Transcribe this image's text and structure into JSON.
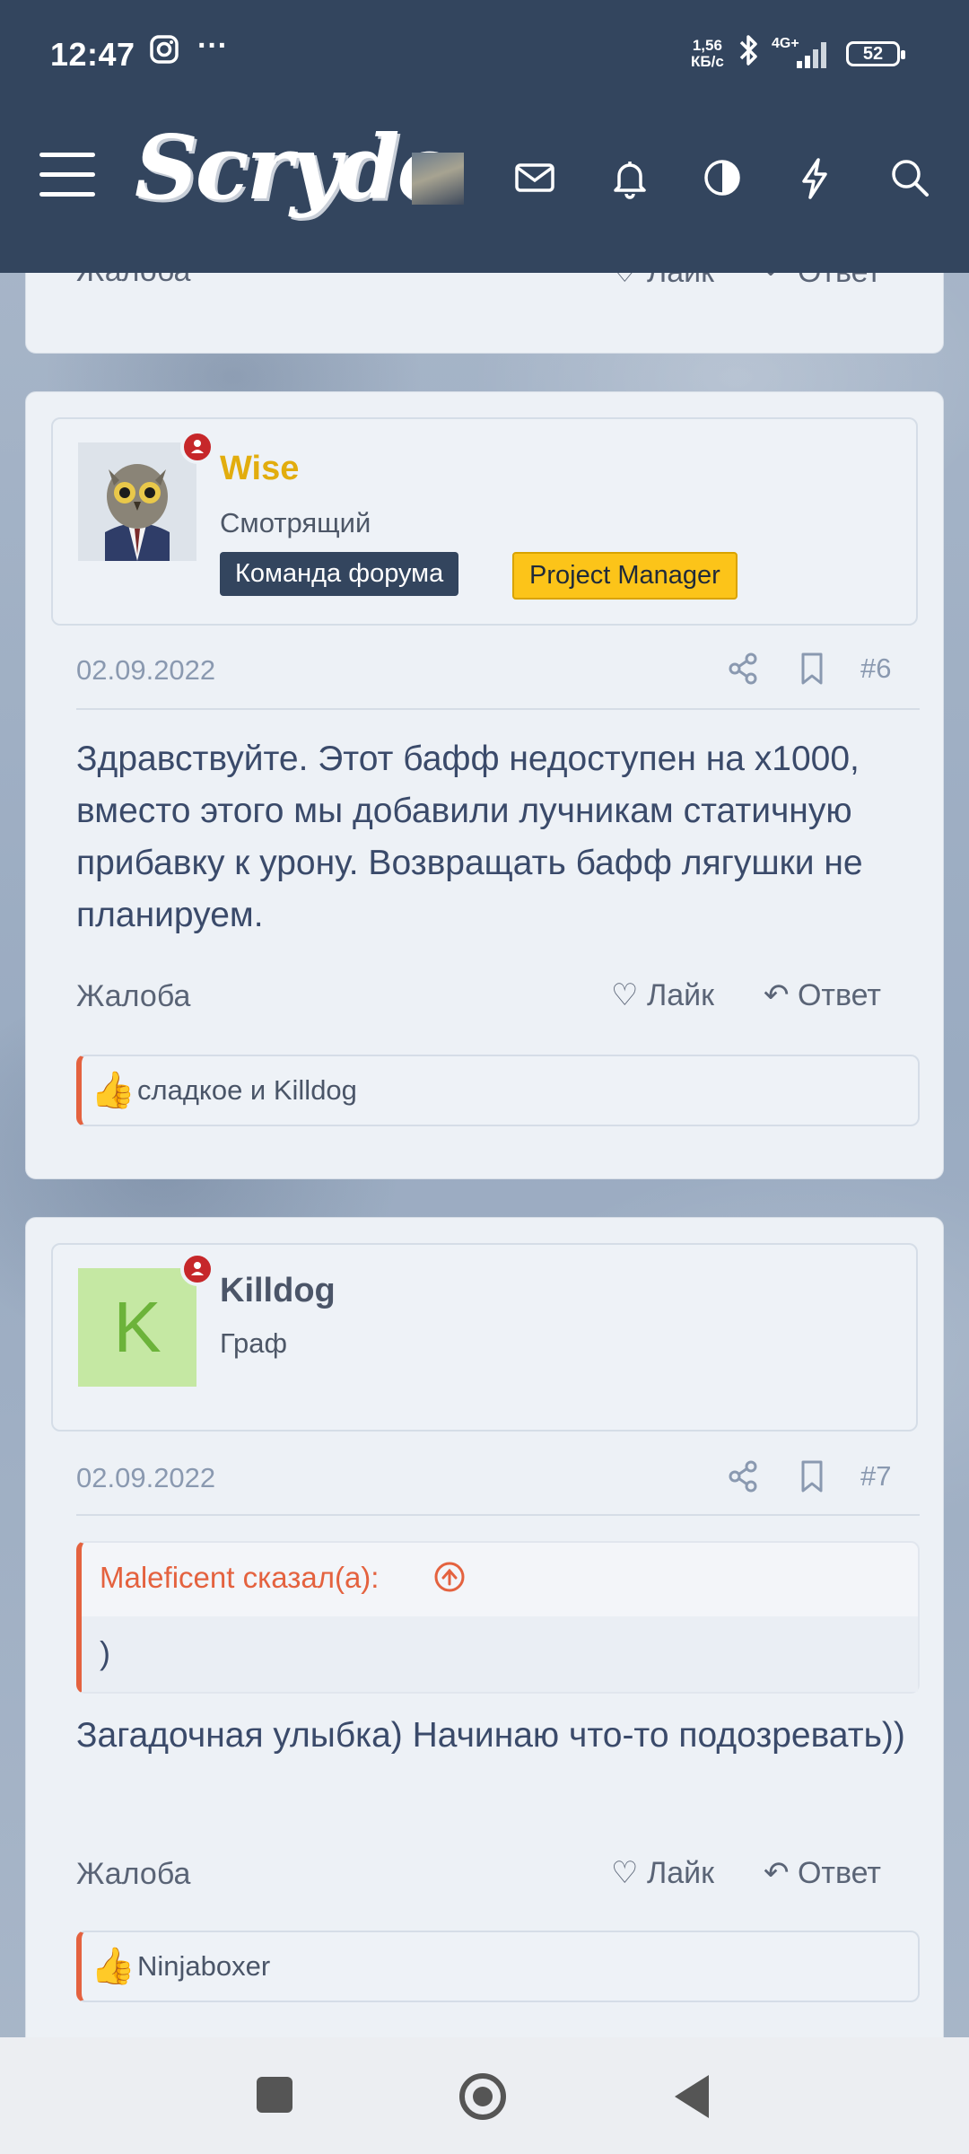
{
  "status_bar": {
    "time": "12:47",
    "net_speed_top": "1,56",
    "net_speed_bottom": "КБ/с",
    "network": "4G+",
    "battery": "52"
  },
  "header": {
    "logo": "Scryde",
    "icons": [
      "menu-icon",
      "mail-icon",
      "bell-icon",
      "contrast-icon",
      "bolt-icon",
      "search-icon"
    ]
  },
  "prev_post": {
    "report": "Жалоба",
    "like": "Лайк",
    "reply": "Ответ"
  },
  "posts": [
    {
      "username": "Wise",
      "user_title": "Смотрящий",
      "badges": [
        "Команда форума",
        "Project Manager"
      ],
      "date": "02.09.2022",
      "number": "#6",
      "text": "Здравствуйте. Этот бафф недоступен на x1000, вместо этого мы добавили лучникам статичную прибавку к урону. Возвращать бафф лягушки не планируем.",
      "report": "Жалоба",
      "like": "Лайк",
      "reply": "Ответ",
      "reactions": "сладкое и Killdog"
    },
    {
      "username": "Killdog",
      "avatar_letter": "K",
      "user_title": "Граф",
      "date": "02.09.2022",
      "number": "#7",
      "quote_author": "Maleficent сказал(а):",
      "quote_text": ")",
      "text": "Загадочная улыбка) Начинаю что-то подозревать))",
      "report": "Жалоба",
      "like": "Лайк",
      "reply": "Ответ",
      "reactions": "Ninjaboxer"
    }
  ],
  "colors": {
    "header": "#33455e",
    "staff_name": "#e2ad0e",
    "badge_team": "#33455e",
    "badge_pm": "#fcc419",
    "accent": "#e4623f",
    "online": "#c6272a"
  }
}
